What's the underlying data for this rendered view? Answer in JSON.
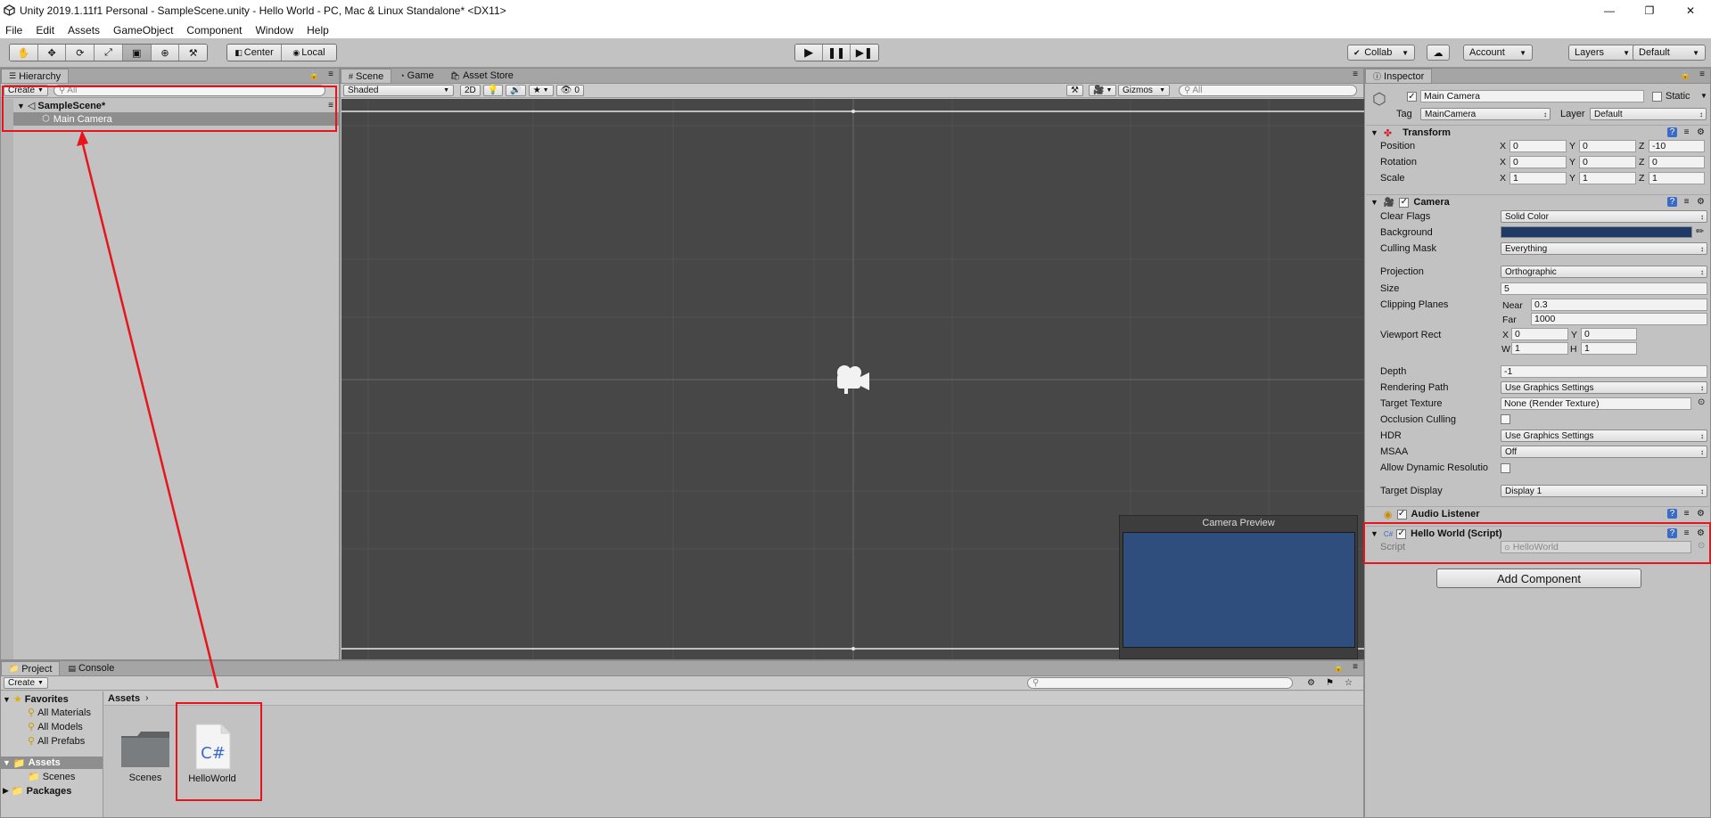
{
  "window": {
    "title": "Unity 2019.1.11f1 Personal - SampleScene.unity - Hello World - PC, Mac & Linux Standalone* <DX11>",
    "minimize": "—",
    "restore": "❐",
    "close": "✕"
  },
  "menu": [
    "File",
    "Edit",
    "Assets",
    "GameObject",
    "Component",
    "Window",
    "Help"
  ],
  "toolbar": {
    "pivot": "Center",
    "space": "Local",
    "collab": "Collab",
    "account": "Account",
    "layers": "Layers",
    "layout": "Default"
  },
  "hierarchy": {
    "tab": "Hierarchy",
    "create": "Create",
    "search_placeholder": "All",
    "scene": "SampleScene*",
    "items": [
      "Main Camera"
    ]
  },
  "scene_view": {
    "tabs": [
      "Scene",
      "Game",
      "Asset Store"
    ],
    "shading": "Shaded",
    "mode_2d": "2D",
    "hidden_count": "0",
    "gizmos": "Gizmos",
    "search_placeholder": "All",
    "camera_preview_title": "Camera Preview",
    "preview_color": "#2f4e7e"
  },
  "inspector": {
    "tab": "Inspector",
    "object_name": "Main Camera",
    "static_label": "Static",
    "tag_label": "Tag",
    "tag_value": "MainCamera",
    "layer_label": "Layer",
    "layer_value": "Default",
    "transform": {
      "title": "Transform",
      "position_label": "Position",
      "rotation_label": "Rotation",
      "scale_label": "Scale",
      "position": [
        "0",
        "0",
        "-10"
      ],
      "rotation": [
        "0",
        "0",
        "0"
      ],
      "scale": [
        "1",
        "1",
        "1"
      ]
    },
    "camera": {
      "title": "Camera",
      "clear_flags_label": "Clear Flags",
      "clear_flags": "Solid Color",
      "background_label": "Background",
      "background_color": "#1f3a66",
      "culling_mask_label": "Culling Mask",
      "culling_mask": "Everything",
      "projection_label": "Projection",
      "projection": "Orthographic",
      "size_label": "Size",
      "size": "5",
      "clipping_label": "Clipping Planes",
      "near_label": "Near",
      "near": "0.3",
      "far_label": "Far",
      "far": "1000",
      "viewport_label": "Viewport Rect",
      "vp_x": "0",
      "vp_y": "0",
      "vp_w": "1",
      "vp_h": "1",
      "depth_label": "Depth",
      "depth": "-1",
      "rendering_path_label": "Rendering Path",
      "rendering_path": "Use Graphics Settings",
      "target_texture_label": "Target Texture",
      "target_texture": "None (Render Texture)",
      "occlusion_label": "Occlusion Culling",
      "hdr_label": "HDR",
      "hdr": "Use Graphics Settings",
      "msaa_label": "MSAA",
      "msaa": "Off",
      "dynres_label": "Allow Dynamic Resolutio",
      "target_display_label": "Target Display",
      "target_display": "Display 1"
    },
    "audio_listener": "Audio Listener",
    "script_component": {
      "title": "Hello World (Script)",
      "script_label": "Script",
      "script_value": "HelloWorld"
    },
    "add_component": "Add Component"
  },
  "project": {
    "tabs": [
      "Project",
      "Console"
    ],
    "create": "Create",
    "favorites": "Favorites",
    "favorite_items": [
      "All Materials",
      "All Models",
      "All Prefabs"
    ],
    "assets_root": "Assets",
    "asset_folders": [
      "Scenes"
    ],
    "packages": "Packages",
    "breadcrumb": "Assets",
    "files": [
      {
        "name": "Scenes",
        "type": "folder"
      },
      {
        "name": "HelloWorld",
        "type": "script",
        "glyph": "C#"
      }
    ]
  },
  "colors": {
    "highlight": "#e8141c",
    "scene_bg": "#474747"
  }
}
